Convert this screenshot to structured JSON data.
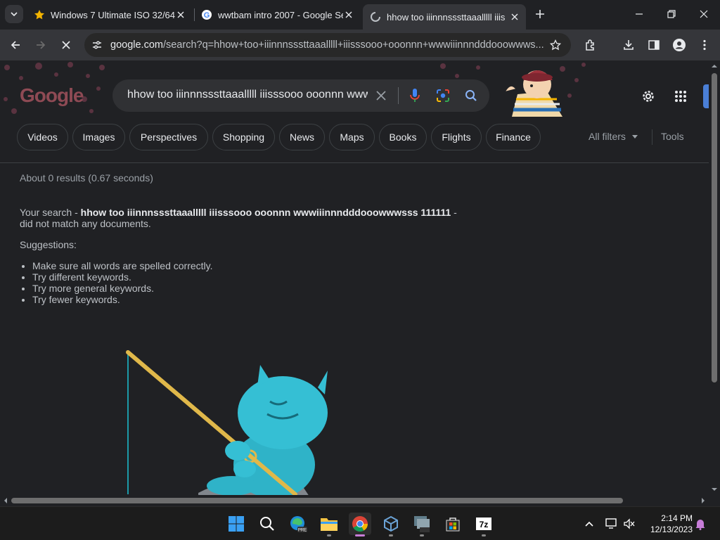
{
  "browser": {
    "tabs": [
      {
        "title": "Windows 7 Ultimate ISO 32/64",
        "favicon": "star-icon",
        "active": false
      },
      {
        "title": "wwtbam intro 2007 - Google Se",
        "favicon": "google-g-icon",
        "active": false
      },
      {
        "title": "hhow too iiinnnsssttaaalllll iiis",
        "favicon": "loading-icon",
        "active": true
      }
    ],
    "url_host": "google.com",
    "url_path": "/search?q=hhow+too+iiinnnsssttaaalllll+iiisssooo+ooonnn+wwwiiinnndddooowwws..."
  },
  "search": {
    "query": "hhow too iiinnnsssttaaalllll iiisssooo ooonnn wwwiiinnndddooowwwsss 111111",
    "logo_text": "Google",
    "chips": [
      "Videos",
      "Images",
      "Perspectives",
      "Shopping",
      "News",
      "Maps",
      "Books",
      "Flights",
      "Finance"
    ],
    "all_filters": "All filters",
    "tools": "Tools"
  },
  "results": {
    "stats": "About 0 results (0.67 seconds)",
    "message_prefix": "Your search - ",
    "message_query": "hhow too iiinnnsssttaaalllll iiisssooo ooonnn wwwiiinnndddooowwwsss 111111",
    "message_suffix": " - did not match any documents.",
    "suggestions_title": "Suggestions:",
    "suggestions": [
      "Make sure all words are spelled correctly.",
      "Try different keywords.",
      "Try more general keywords.",
      "Try fewer keywords."
    ]
  },
  "taskbar": {
    "apps": [
      "start-icon",
      "search-icon",
      "edge-pre-icon",
      "file-explorer-icon",
      "chrome-icon",
      "virtualbox-icon",
      "vmware-icon",
      "store-icon",
      "7zip-icon"
    ],
    "time": "2:14 PM",
    "date": "12/13/2023"
  },
  "colors": {
    "background": "#202124",
    "toolbar": "#35363a",
    "accent_blue": "#8ab4f8"
  }
}
